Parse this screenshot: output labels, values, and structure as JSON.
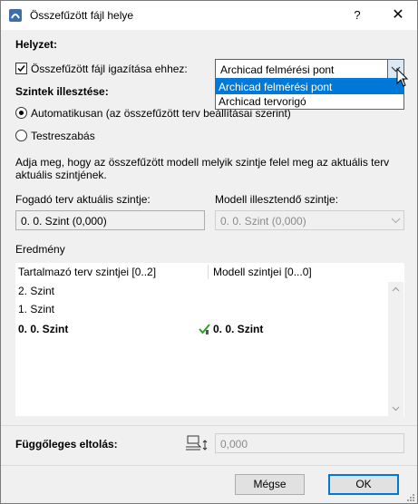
{
  "title": "Összefűzött fájl helye",
  "titlebar": {
    "help": "?",
    "close": "✕"
  },
  "position_heading": "Helyzet:",
  "align_checkbox_label": "Összefűzött fájl igazítása ehhez:",
  "align_checkbox_checked": true,
  "align_combo": {
    "selected": "Archicad felmérési pont",
    "options": [
      "Archicad felmérési pont",
      "Archicad tervorigó"
    ],
    "highlighted_index": 0
  },
  "levels_heading": "Szintek illesztése:",
  "radio_auto_label": "Automatikusan (az összefűzött terv beállításai szerint)",
  "radio_auto_checked": true,
  "radio_custom_label": "Testreszabás",
  "description": [
    "Adja meg, hogy az összefűzött modell melyik szintje felel meg az aktuális terv",
    "aktuális szintjének."
  ],
  "host_story_label": "Fogadó terv aktuális szintje:",
  "host_story_value": "0. 0. Szint (0,000)",
  "model_story_label": "Modell illesztendő szintje:",
  "model_story_value": "0. 0. Szint (0,000)",
  "result_heading": "Eredmény",
  "result_table": {
    "columns": [
      "Tartalmazó terv szintjei [0..2]",
      "Modell szintjei [0...0]"
    ],
    "rows": [
      {
        "host": "2. Szint",
        "model": "",
        "bold": false
      },
      {
        "host": "1. Szint",
        "model": "",
        "bold": false
      },
      {
        "host": "0. 0. Szint",
        "model": "0. 0. Szint",
        "bold": true
      }
    ]
  },
  "offset_label": "Függőleges eltolás:",
  "offset_value": "0,000",
  "buttons": {
    "cancel": "Mégse",
    "ok": "OK"
  },
  "colors": {
    "accent": "#0078d7",
    "check_green": "#2ca02c"
  }
}
